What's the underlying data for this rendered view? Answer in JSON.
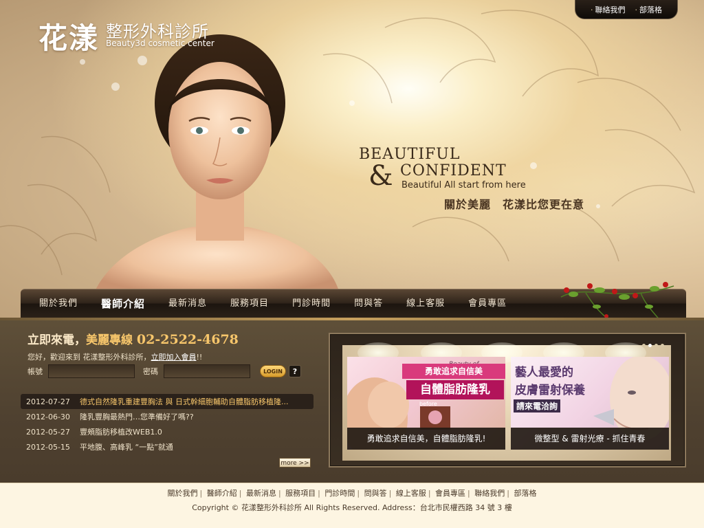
{
  "logo": {
    "main": "花漾",
    "sub": "整形外科診所",
    "english": "Beauty3d cosmetic center"
  },
  "top_links": [
    "聯絡我們",
    "部落格"
  ],
  "slogan": {
    "line1": "BEAUTIFUL",
    "ampersand": "&",
    "line2": "CONFIDENT",
    "line3": "Beautiful  All start from here",
    "chinese": "關於美麗　花漾比您更在意"
  },
  "nav": {
    "items": [
      "關於我們",
      "醫師介紹",
      "最新消息",
      "服務項目",
      "門診時間",
      "問與答",
      "線上客服",
      "會員專區"
    ],
    "active_index": 1
  },
  "contact": {
    "prefix": "立即來電，",
    "accent": "美麗專線",
    "phone": "02-2522-4678"
  },
  "welcome": {
    "text": "您好，歡迎來到 花漾整形外科診所，",
    "link": "立即加入會員",
    "suffix": "!!"
  },
  "login": {
    "account_label": "帳號",
    "password_label": "密碼",
    "login_button": "LOGIN",
    "help_button": "?"
  },
  "news": [
    {
      "date": "2012-07-27",
      "title": "德式自然隆乳重建豐胸法 與 日式幹細胞輔助自體脂肪移植隆..."
    },
    {
      "date": "2012-06-30",
      "title": "隆乳豐胸最熱門…您準備好了嗎??"
    },
    {
      "date": "2012-05-27",
      "title": "豐頰脂肪移植改WEB1.0"
    },
    {
      "date": "2012-05-15",
      "title": "平地腹、高峰乳 “一點”就通"
    }
  ],
  "more_button": "more >>",
  "promos": [
    {
      "caption": "勇敢追求自信美，自體脂肪隆乳!",
      "band": "勇敢追求自信美",
      "headline": "自體脂肪隆乳",
      "before_label": "before",
      "tag": "Beauty of"
    },
    {
      "caption": "微整型 & 雷射光療 - 抓住青春",
      "line1": "藝人最愛的",
      "line2": "皮膚雷射保養",
      "line3": "請來電洽詢"
    }
  ],
  "footer": {
    "links": [
      "關於我們",
      "醫師介紹",
      "最新消息",
      "服務項目",
      "門診時間",
      "問與答",
      "線上客服",
      "會員專區",
      "聯絡我們",
      "部落格"
    ],
    "copyright": "Copyright © 花漾整形外科診所 All Rights Reserved.    Address：台北市民權西路 34 號 3 樓"
  },
  "colors": {
    "accent_gold": "#f7c66b",
    "nav_bg": "#2f241a",
    "promo_pink": "#b2135a"
  }
}
